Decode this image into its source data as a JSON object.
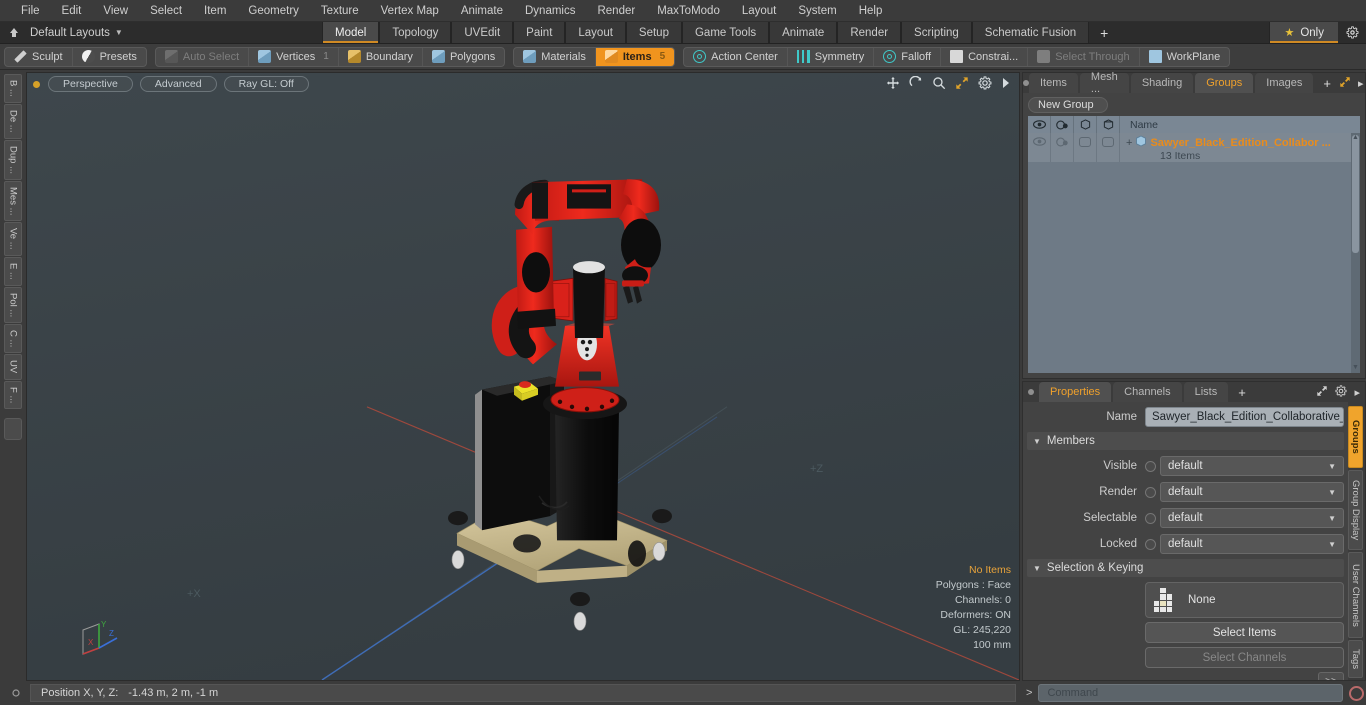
{
  "app": {
    "menu": [
      "File",
      "Edit",
      "View",
      "Select",
      "Item",
      "Geometry",
      "Texture",
      "Vertex Map",
      "Animate",
      "Dynamics",
      "Render",
      "MaxToModo",
      "Layout",
      "System",
      "Help"
    ]
  },
  "layoutbar": {
    "layout_name": "Default Layouts",
    "tabs": [
      "Model",
      "Topology",
      "UVEdit",
      "Paint",
      "Layout",
      "Setup",
      "Game Tools",
      "Animate",
      "Render",
      "Scripting",
      "Schematic Fusion"
    ],
    "active_tab": "Model",
    "plus_label": "+",
    "only_label": "Only",
    "gear_icon": "gear-icon"
  },
  "modebar": {
    "left_group": [
      {
        "label": "Sculpt",
        "icon": "pencil-icon",
        "state": "normal"
      },
      {
        "label": "Presets",
        "icon": "sphere-icon",
        "state": "normal"
      }
    ],
    "selection_group": [
      {
        "label": "Auto Select",
        "icon": "cube-icon",
        "state": "disabled",
        "count": ""
      },
      {
        "label": "Vertices",
        "icon": "cube-icon",
        "state": "normal",
        "count": "1"
      },
      {
        "label": "Boundary",
        "icon": "cube-icon",
        "state": "normal",
        "count": ""
      },
      {
        "label": "Polygons",
        "icon": "cube-icon",
        "state": "normal",
        "count": ""
      }
    ],
    "mode_group": [
      {
        "label": "Materials",
        "icon": "cube-icon",
        "state": "normal",
        "count": ""
      },
      {
        "label": "Items",
        "icon": "cube-icon",
        "state": "selected",
        "count": "5"
      }
    ],
    "tools_group": [
      {
        "label": "Action Center",
        "icon": "action-center-icon",
        "state": "normal"
      },
      {
        "label": "Symmetry",
        "icon": "symmetry-icon",
        "state": "normal"
      },
      {
        "label": "Falloff",
        "icon": "falloff-icon",
        "state": "normal"
      },
      {
        "label": "Constrai...",
        "icon": "constraint-icon",
        "state": "normal"
      },
      {
        "label": "Select Through",
        "icon": "select-through-icon",
        "state": "disabled"
      },
      {
        "label": "WorkPlane",
        "icon": "workplane-icon",
        "state": "normal"
      }
    ]
  },
  "left_toolstrip": {
    "tabs": [
      "B ...",
      "De ...",
      "Dup ...",
      "Mes ...",
      "Ve ...",
      "E ...",
      "Pol ...",
      "C ...",
      "UV",
      "F ..."
    ]
  },
  "viewport": {
    "pills": [
      "Perspective",
      "Advanced",
      "Ray GL: Off"
    ],
    "icons": [
      "move-icon",
      "rotate-icon",
      "zoom-icon",
      "fit-icon",
      "gear-icon",
      "play-icon"
    ],
    "stats": {
      "selection": "No Items",
      "polygons": "Polygons : Face",
      "channels": "Channels: 0",
      "deformers": "Deformers: ON",
      "gl": "GL: 245,220",
      "units": "100 mm"
    },
    "axis_labels": {
      "x": "+X",
      "z": "+Z"
    },
    "gizmo_axes": [
      "X",
      "Y",
      "Z"
    ],
    "bg_color": "#3a4348",
    "model_name": "Sawyer Black Edition Collaborative Robot"
  },
  "groups_panel": {
    "tabs": [
      "Items",
      "Mesh ...",
      "Shading",
      "Groups",
      "Images"
    ],
    "active_tab": "Groups",
    "plus_label": "+",
    "new_group_label": "New Group",
    "columns": [
      "visible-icon",
      "render-icon",
      "selectable-icon",
      "lock-icon"
    ],
    "name_header": "Name",
    "rows": [
      {
        "name": "Sawyer_Black_Edition_Collabor  ...",
        "sub": "13 Items",
        "expander": "+"
      }
    ]
  },
  "properties_panel": {
    "tabs": [
      "Properties",
      "Channels",
      "Lists"
    ],
    "active_tab": "Properties",
    "plus_label": "+",
    "name_label": "Name",
    "name_value": "Sawyer_Black_Edition_Collaborative_R",
    "members_section": "Members",
    "members": [
      {
        "label": "Visible",
        "value": "default"
      },
      {
        "label": "Render",
        "value": "default"
      },
      {
        "label": "Selectable",
        "value": "default"
      },
      {
        "label": "Locked",
        "value": "default"
      }
    ],
    "selection_section": "Selection & Keying",
    "selection_value": "None",
    "select_items_label": "Select Items",
    "select_channels_label": "Select Channels",
    "more_label": ">>",
    "right_tabs": [
      "Groups",
      "Group Display",
      "User Channels",
      "Tags"
    ],
    "right_tab_active": "Groups"
  },
  "bottom": {
    "position_label": "Position X, Y, Z:",
    "position_value": "-1.43 m, 2 m, -1 m",
    "command_prompt": ">",
    "command_placeholder": "Command",
    "record_icon": "record-icon"
  },
  "colors": {
    "accent_orange": "#f0941e",
    "panel_bg": "#3b3b3b",
    "viewport_bg": "#3a4348",
    "list_bg": "#7d8893",
    "robot_red": "#e02020",
    "robot_black": "#141414",
    "base_tan": "#cfc08a"
  }
}
